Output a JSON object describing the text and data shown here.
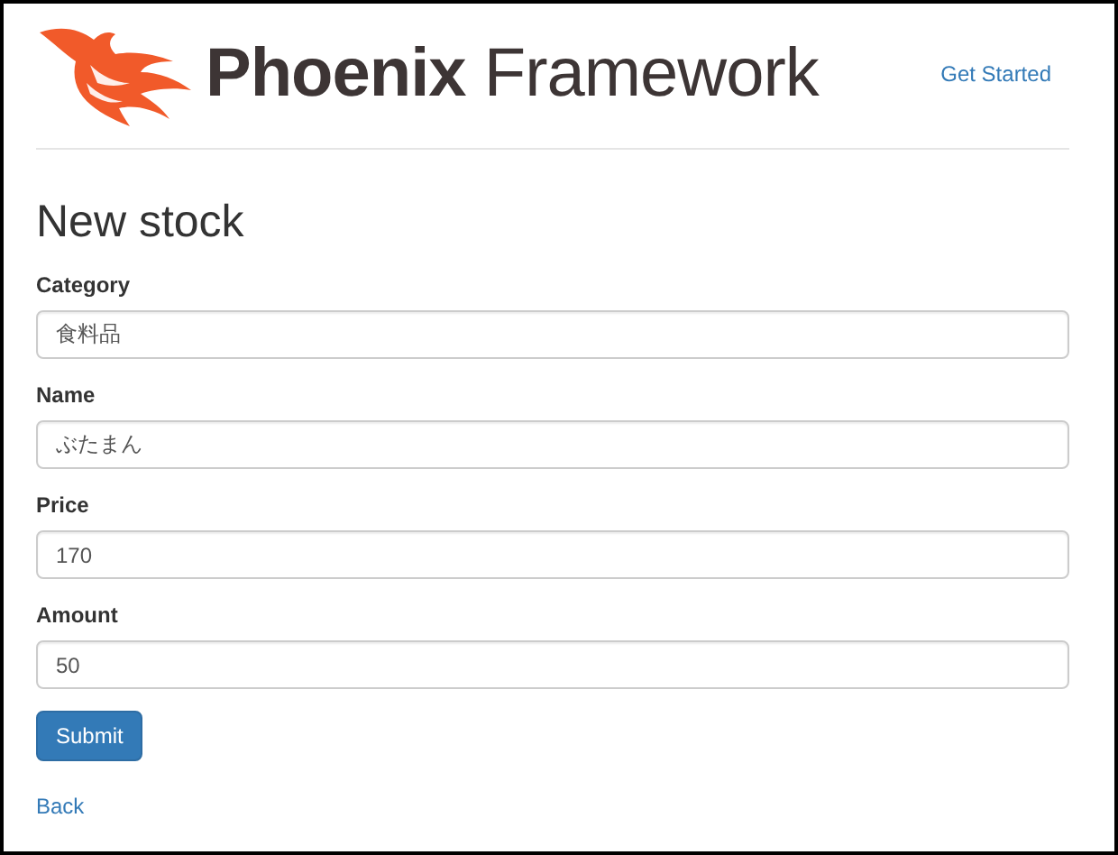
{
  "header": {
    "logo": {
      "bold": "Phoenix",
      "light": "Framework"
    },
    "nav_link": "Get Started"
  },
  "title": "New stock",
  "fields": [
    {
      "label": "Category",
      "value": "食料品"
    },
    {
      "label": "Name",
      "value": "ぶたまん"
    },
    {
      "label": "Price",
      "value": "170"
    },
    {
      "label": "Amount",
      "value": "50"
    }
  ],
  "submit": "Submit",
  "back_link": "Back"
}
